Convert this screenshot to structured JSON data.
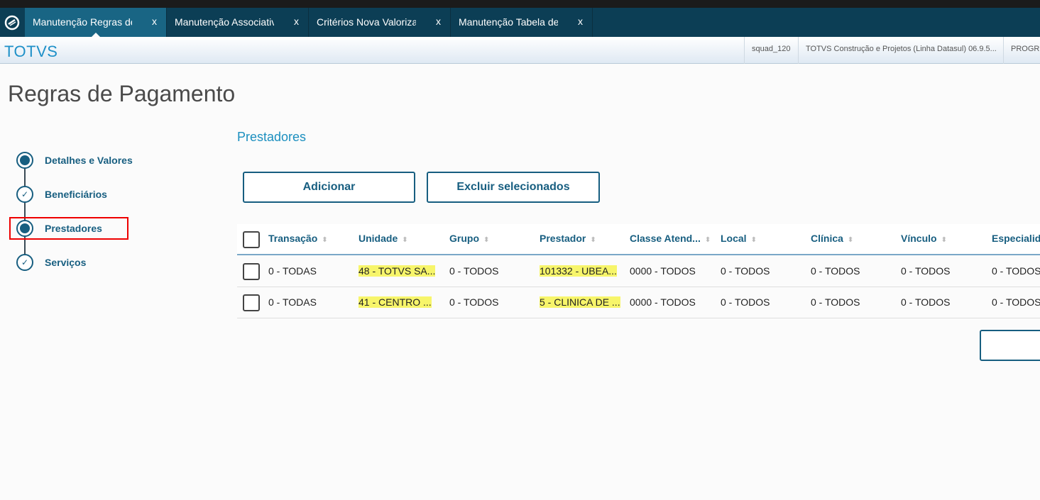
{
  "tabs": [
    {
      "label": "Manutenção Regras de",
      "close": "x"
    },
    {
      "label": "Manutenção Associativ",
      "close": "x"
    },
    {
      "label": "Critérios Nova Valoriza",
      "close": "x"
    },
    {
      "label": "Manutenção Tabela de",
      "close": "x"
    }
  ],
  "header": {
    "brand": "TOTVS",
    "info": [
      "squad_120",
      "TOTVS Construção e Projetos (Linha Datasul) 06.9.5...",
      "PROGR"
    ]
  },
  "page": {
    "title": "Regras de Pagamento"
  },
  "steps": [
    {
      "label": "Detalhes e Valores",
      "state": "current"
    },
    {
      "label": "Beneficiários",
      "state": "done"
    },
    {
      "label": "Prestadores",
      "state": "current"
    },
    {
      "label": "Serviços",
      "state": "done"
    }
  ],
  "section": {
    "title": "Prestadores"
  },
  "buttons": {
    "add": "Adicionar",
    "delete_selected": "Excluir selecionados"
  },
  "table": {
    "columns": [
      "Transação",
      "Unidade",
      "Grupo",
      "Prestador",
      "Classe Atend...",
      "Local",
      "Clínica",
      "Vínculo",
      "Especialida"
    ],
    "rows": [
      [
        "0 - TODAS",
        "48 - TOTVS SA...",
        "0 - TODOS",
        "101332 - UBEA...",
        "0000 - TODOS",
        "0 - TODOS",
        "0 - TODOS",
        "0 - TODOS",
        "0 - TODOS"
      ],
      [
        "0 - TODAS",
        "41 - CENTRO ...",
        "0 - TODOS",
        "5 - CLINICA DE ...",
        "0000 - TODOS",
        "0 - TODOS",
        "0 - TODOS",
        "0 - TODOS",
        "0 - TODOS"
      ]
    ]
  },
  "colors": {
    "tabbar": "#0c3e55",
    "active_tab": "#196584",
    "accent": "#175e80",
    "highlight": "#f7f56a",
    "marker": "#e00000"
  }
}
